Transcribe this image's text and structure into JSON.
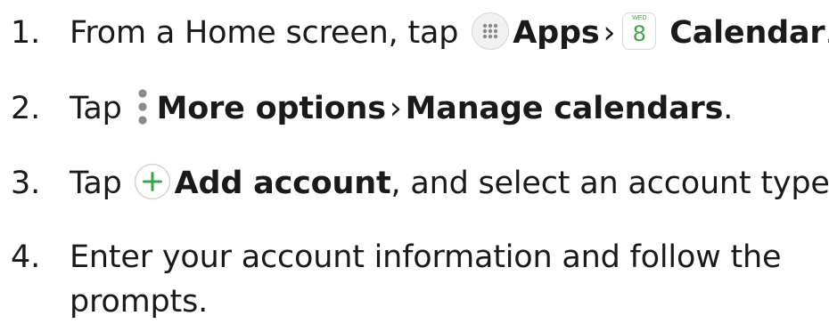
{
  "steps": [
    {
      "number": "1.",
      "prefix": "From a Home screen, tap",
      "apps_label": "Apps",
      "separator": "›",
      "calendar_icon_day": "WED",
      "calendar_icon_date": "8",
      "calendar_label": "Calendar",
      "suffix": "."
    },
    {
      "number": "2.",
      "prefix": "Tap",
      "more_options_label": "More options",
      "separator": "›",
      "manage_label": "Manage calendars",
      "suffix": "."
    },
    {
      "number": "3.",
      "prefix": "Tap",
      "add_account_label": "Add account",
      "suffix": ", and select an account type."
    },
    {
      "number": "4.",
      "text": "Enter your account information and follow the prompts."
    }
  ],
  "colors": {
    "text": "#1a1a1a",
    "accent_green": "#3ba845",
    "icon_gray": "#8a8a8a"
  },
  "icons": {
    "apps": "apps-grid-icon",
    "calendar": "calendar-icon",
    "more_options": "more-options-icon",
    "add": "add-icon"
  }
}
